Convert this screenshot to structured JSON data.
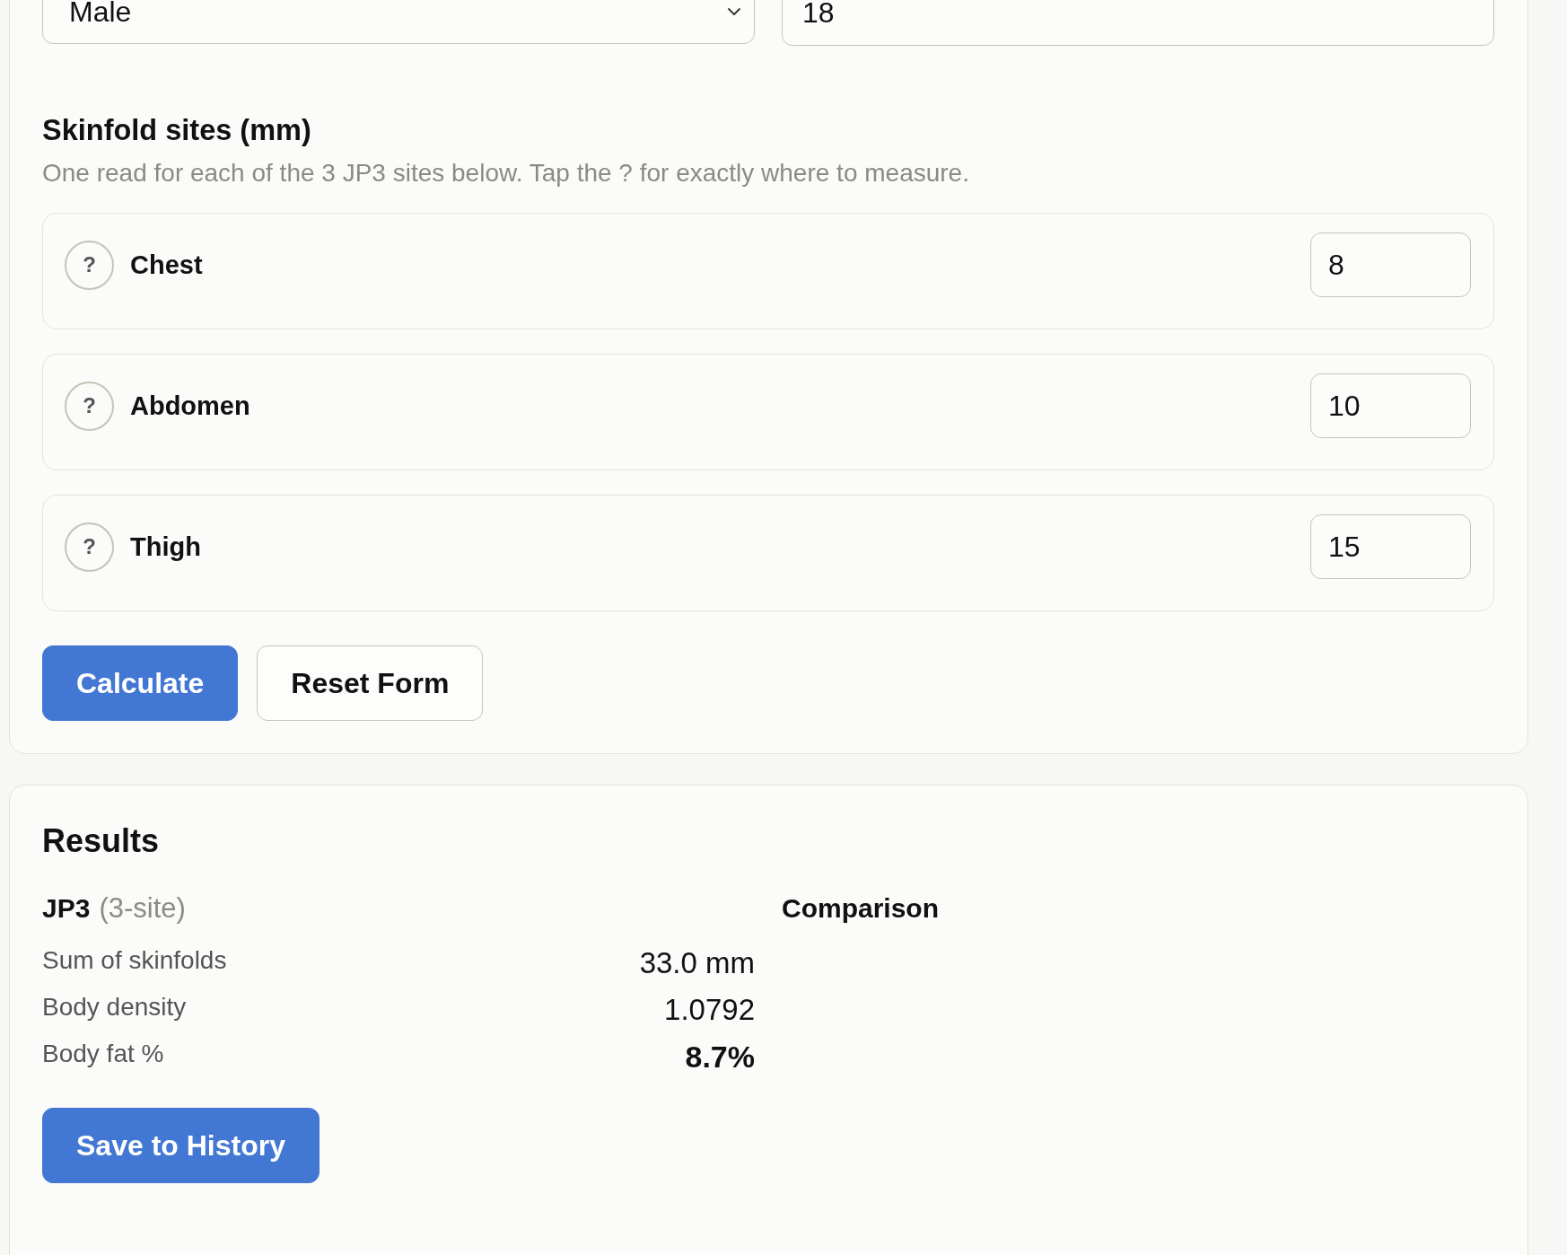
{
  "profile_fields": [
    {
      "kind": "select",
      "value": "Male"
    },
    {
      "kind": "input",
      "value": "18"
    }
  ],
  "skinfold_section": {
    "title": "Skinfold sites (mm)",
    "hint": "One read for each of the 3 JP3 sites below. Tap the ? for exactly where to measure.",
    "sites": [
      {
        "help": "?",
        "name": "Chest",
        "value": "8"
      },
      {
        "help": "?",
        "name": "Abdomen",
        "value": "10"
      },
      {
        "help": "?",
        "name": "Thigh",
        "value": "15"
      }
    ]
  },
  "form_buttons": [
    {
      "kind": "primary",
      "label": "Calculate"
    },
    {
      "kind": "secondary",
      "label": "Reset Form"
    }
  ],
  "results": {
    "title": "Results",
    "method": {
      "name": "JP3",
      "detail": "(3-site)"
    },
    "metrics": [
      {
        "label": "Sum of skinfolds",
        "value": "33.0 mm",
        "emphasis": false
      },
      {
        "label": "Body density",
        "value": "1.0792",
        "emphasis": false
      },
      {
        "label": "Body fat %",
        "value": "8.7%",
        "emphasis": true
      }
    ],
    "comparison": {
      "title": "Comparison"
    },
    "save_button": {
      "label": "Save to History"
    }
  }
}
